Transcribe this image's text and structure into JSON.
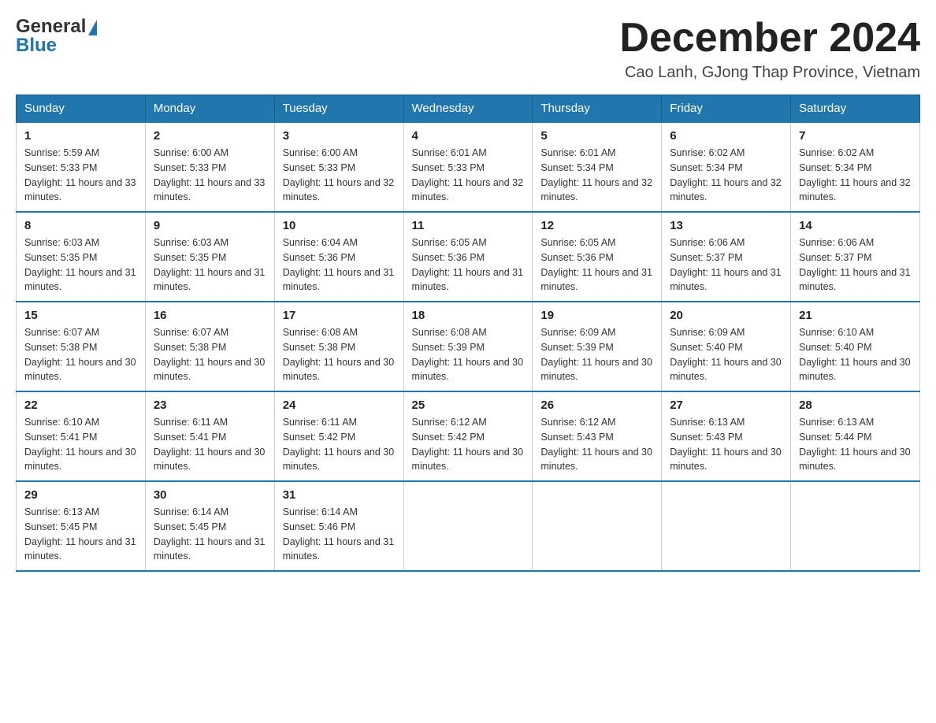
{
  "logo": {
    "general": "General",
    "blue": "Blue",
    "triangle": "▲"
  },
  "header": {
    "month_title": "December 2024",
    "location": "Cao Lanh, GJong Thap Province, Vietnam"
  },
  "days_of_week": [
    "Sunday",
    "Monday",
    "Tuesday",
    "Wednesday",
    "Thursday",
    "Friday",
    "Saturday"
  ],
  "weeks": [
    [
      {
        "day": "1",
        "sunrise": "Sunrise: 5:59 AM",
        "sunset": "Sunset: 5:33 PM",
        "daylight": "Daylight: 11 hours and 33 minutes."
      },
      {
        "day": "2",
        "sunrise": "Sunrise: 6:00 AM",
        "sunset": "Sunset: 5:33 PM",
        "daylight": "Daylight: 11 hours and 33 minutes."
      },
      {
        "day": "3",
        "sunrise": "Sunrise: 6:00 AM",
        "sunset": "Sunset: 5:33 PM",
        "daylight": "Daylight: 11 hours and 32 minutes."
      },
      {
        "day": "4",
        "sunrise": "Sunrise: 6:01 AM",
        "sunset": "Sunset: 5:33 PM",
        "daylight": "Daylight: 11 hours and 32 minutes."
      },
      {
        "day": "5",
        "sunrise": "Sunrise: 6:01 AM",
        "sunset": "Sunset: 5:34 PM",
        "daylight": "Daylight: 11 hours and 32 minutes."
      },
      {
        "day": "6",
        "sunrise": "Sunrise: 6:02 AM",
        "sunset": "Sunset: 5:34 PM",
        "daylight": "Daylight: 11 hours and 32 minutes."
      },
      {
        "day": "7",
        "sunrise": "Sunrise: 6:02 AM",
        "sunset": "Sunset: 5:34 PM",
        "daylight": "Daylight: 11 hours and 32 minutes."
      }
    ],
    [
      {
        "day": "8",
        "sunrise": "Sunrise: 6:03 AM",
        "sunset": "Sunset: 5:35 PM",
        "daylight": "Daylight: 11 hours and 31 minutes."
      },
      {
        "day": "9",
        "sunrise": "Sunrise: 6:03 AM",
        "sunset": "Sunset: 5:35 PM",
        "daylight": "Daylight: 11 hours and 31 minutes."
      },
      {
        "day": "10",
        "sunrise": "Sunrise: 6:04 AM",
        "sunset": "Sunset: 5:36 PM",
        "daylight": "Daylight: 11 hours and 31 minutes."
      },
      {
        "day": "11",
        "sunrise": "Sunrise: 6:05 AM",
        "sunset": "Sunset: 5:36 PM",
        "daylight": "Daylight: 11 hours and 31 minutes."
      },
      {
        "day": "12",
        "sunrise": "Sunrise: 6:05 AM",
        "sunset": "Sunset: 5:36 PM",
        "daylight": "Daylight: 11 hours and 31 minutes."
      },
      {
        "day": "13",
        "sunrise": "Sunrise: 6:06 AM",
        "sunset": "Sunset: 5:37 PM",
        "daylight": "Daylight: 11 hours and 31 minutes."
      },
      {
        "day": "14",
        "sunrise": "Sunrise: 6:06 AM",
        "sunset": "Sunset: 5:37 PM",
        "daylight": "Daylight: 11 hours and 31 minutes."
      }
    ],
    [
      {
        "day": "15",
        "sunrise": "Sunrise: 6:07 AM",
        "sunset": "Sunset: 5:38 PM",
        "daylight": "Daylight: 11 hours and 30 minutes."
      },
      {
        "day": "16",
        "sunrise": "Sunrise: 6:07 AM",
        "sunset": "Sunset: 5:38 PM",
        "daylight": "Daylight: 11 hours and 30 minutes."
      },
      {
        "day": "17",
        "sunrise": "Sunrise: 6:08 AM",
        "sunset": "Sunset: 5:38 PM",
        "daylight": "Daylight: 11 hours and 30 minutes."
      },
      {
        "day": "18",
        "sunrise": "Sunrise: 6:08 AM",
        "sunset": "Sunset: 5:39 PM",
        "daylight": "Daylight: 11 hours and 30 minutes."
      },
      {
        "day": "19",
        "sunrise": "Sunrise: 6:09 AM",
        "sunset": "Sunset: 5:39 PM",
        "daylight": "Daylight: 11 hours and 30 minutes."
      },
      {
        "day": "20",
        "sunrise": "Sunrise: 6:09 AM",
        "sunset": "Sunset: 5:40 PM",
        "daylight": "Daylight: 11 hours and 30 minutes."
      },
      {
        "day": "21",
        "sunrise": "Sunrise: 6:10 AM",
        "sunset": "Sunset: 5:40 PM",
        "daylight": "Daylight: 11 hours and 30 minutes."
      }
    ],
    [
      {
        "day": "22",
        "sunrise": "Sunrise: 6:10 AM",
        "sunset": "Sunset: 5:41 PM",
        "daylight": "Daylight: 11 hours and 30 minutes."
      },
      {
        "day": "23",
        "sunrise": "Sunrise: 6:11 AM",
        "sunset": "Sunset: 5:41 PM",
        "daylight": "Daylight: 11 hours and 30 minutes."
      },
      {
        "day": "24",
        "sunrise": "Sunrise: 6:11 AM",
        "sunset": "Sunset: 5:42 PM",
        "daylight": "Daylight: 11 hours and 30 minutes."
      },
      {
        "day": "25",
        "sunrise": "Sunrise: 6:12 AM",
        "sunset": "Sunset: 5:42 PM",
        "daylight": "Daylight: 11 hours and 30 minutes."
      },
      {
        "day": "26",
        "sunrise": "Sunrise: 6:12 AM",
        "sunset": "Sunset: 5:43 PM",
        "daylight": "Daylight: 11 hours and 30 minutes."
      },
      {
        "day": "27",
        "sunrise": "Sunrise: 6:13 AM",
        "sunset": "Sunset: 5:43 PM",
        "daylight": "Daylight: 11 hours and 30 minutes."
      },
      {
        "day": "28",
        "sunrise": "Sunrise: 6:13 AM",
        "sunset": "Sunset: 5:44 PM",
        "daylight": "Daylight: 11 hours and 30 minutes."
      }
    ],
    [
      {
        "day": "29",
        "sunrise": "Sunrise: 6:13 AM",
        "sunset": "Sunset: 5:45 PM",
        "daylight": "Daylight: 11 hours and 31 minutes."
      },
      {
        "day": "30",
        "sunrise": "Sunrise: 6:14 AM",
        "sunset": "Sunset: 5:45 PM",
        "daylight": "Daylight: 11 hours and 31 minutes."
      },
      {
        "day": "31",
        "sunrise": "Sunrise: 6:14 AM",
        "sunset": "Sunset: 5:46 PM",
        "daylight": "Daylight: 11 hours and 31 minutes."
      },
      null,
      null,
      null,
      null
    ]
  ]
}
